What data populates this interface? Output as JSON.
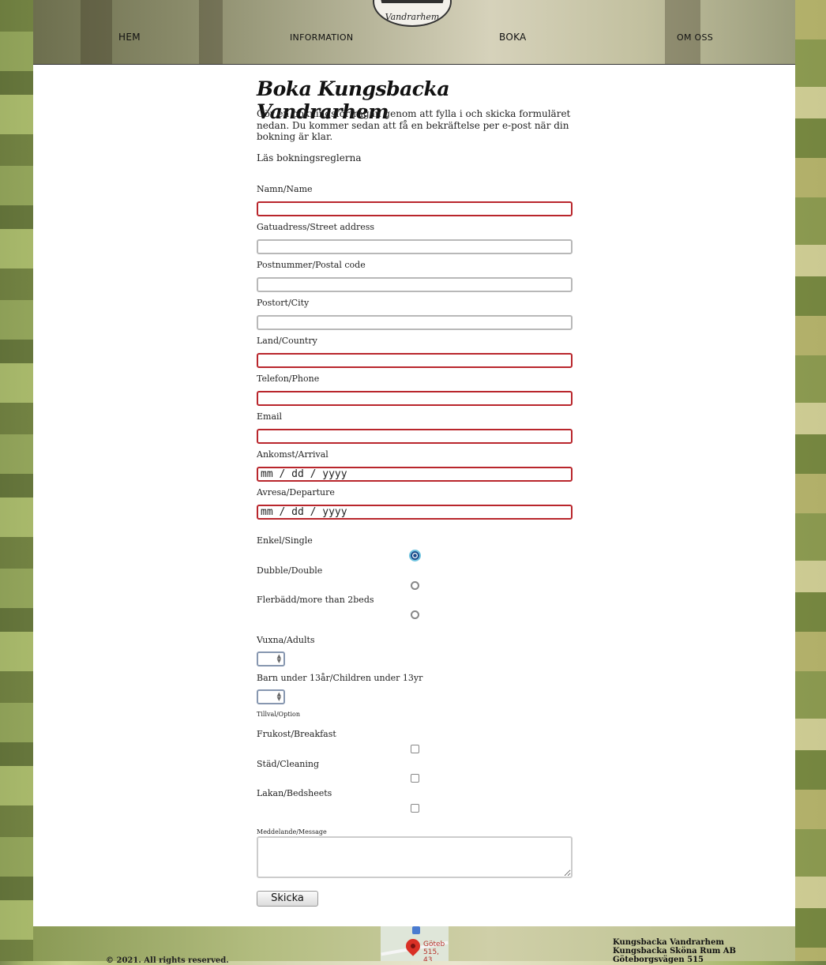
{
  "nav": {
    "items": [
      "HEM",
      "INFORMATION",
      "BOKA",
      "OM OSS"
    ]
  },
  "logo": {
    "text": "Vandrarhem"
  },
  "page": {
    "title": "Boka Kungsbacka Vandrarhem",
    "intro": "Gör en bokningsförfrågan genom att fylla i och skicka formuläret nedan. Du kommer sedan att få en bekräftelse per e-post när din bokning är klar.",
    "rules_link": "Läs bokningsreglerna"
  },
  "form": {
    "name_label": "Namn/Name",
    "street_label": "Gatuadress/Street address",
    "postal_label": "Postnummer/Postal code",
    "city_label": "Postort/City",
    "country_label": "Land/Country",
    "phone_label": "Telefon/Phone",
    "email_label": "Email",
    "arrival_label": "Ankomst/Arrival",
    "arrival_value": "mm / dd / yyyy",
    "departure_label": "Avresa/Departure",
    "departure_value": "mm / dd / yyyy",
    "room_single_label": "Enkel/Single",
    "room_double_label": "Dubble/Double",
    "room_multi_label": "Flerbädd/more than 2beds",
    "adults_label": "Vuxna/Adults",
    "children_label": "Barn under 13år/Children under 13yr",
    "options_label": "Tillval/Option",
    "breakfast_label": "Frukost/Breakfast",
    "cleaning_label": "Städ/Cleaning",
    "sheets_label": "Lakan/Bedsheets",
    "message_label": "Meddelande/Message",
    "submit_label": "Skicka"
  },
  "footer": {
    "copyright": "© 2021. All rights reserved.",
    "map_text_1": "Göteb",
    "map_text_2": "515, 43",
    "address_line_1": "Kungsbacka Vandrarhem",
    "address_line_2": "Kungsbacka Sköna Rum AB",
    "address_line_3": "Göteborgsvägen 515"
  },
  "colors": {
    "required_border": "#b9262c",
    "focus_ring": "#6fc3df",
    "page_bg": "#ffffff"
  }
}
